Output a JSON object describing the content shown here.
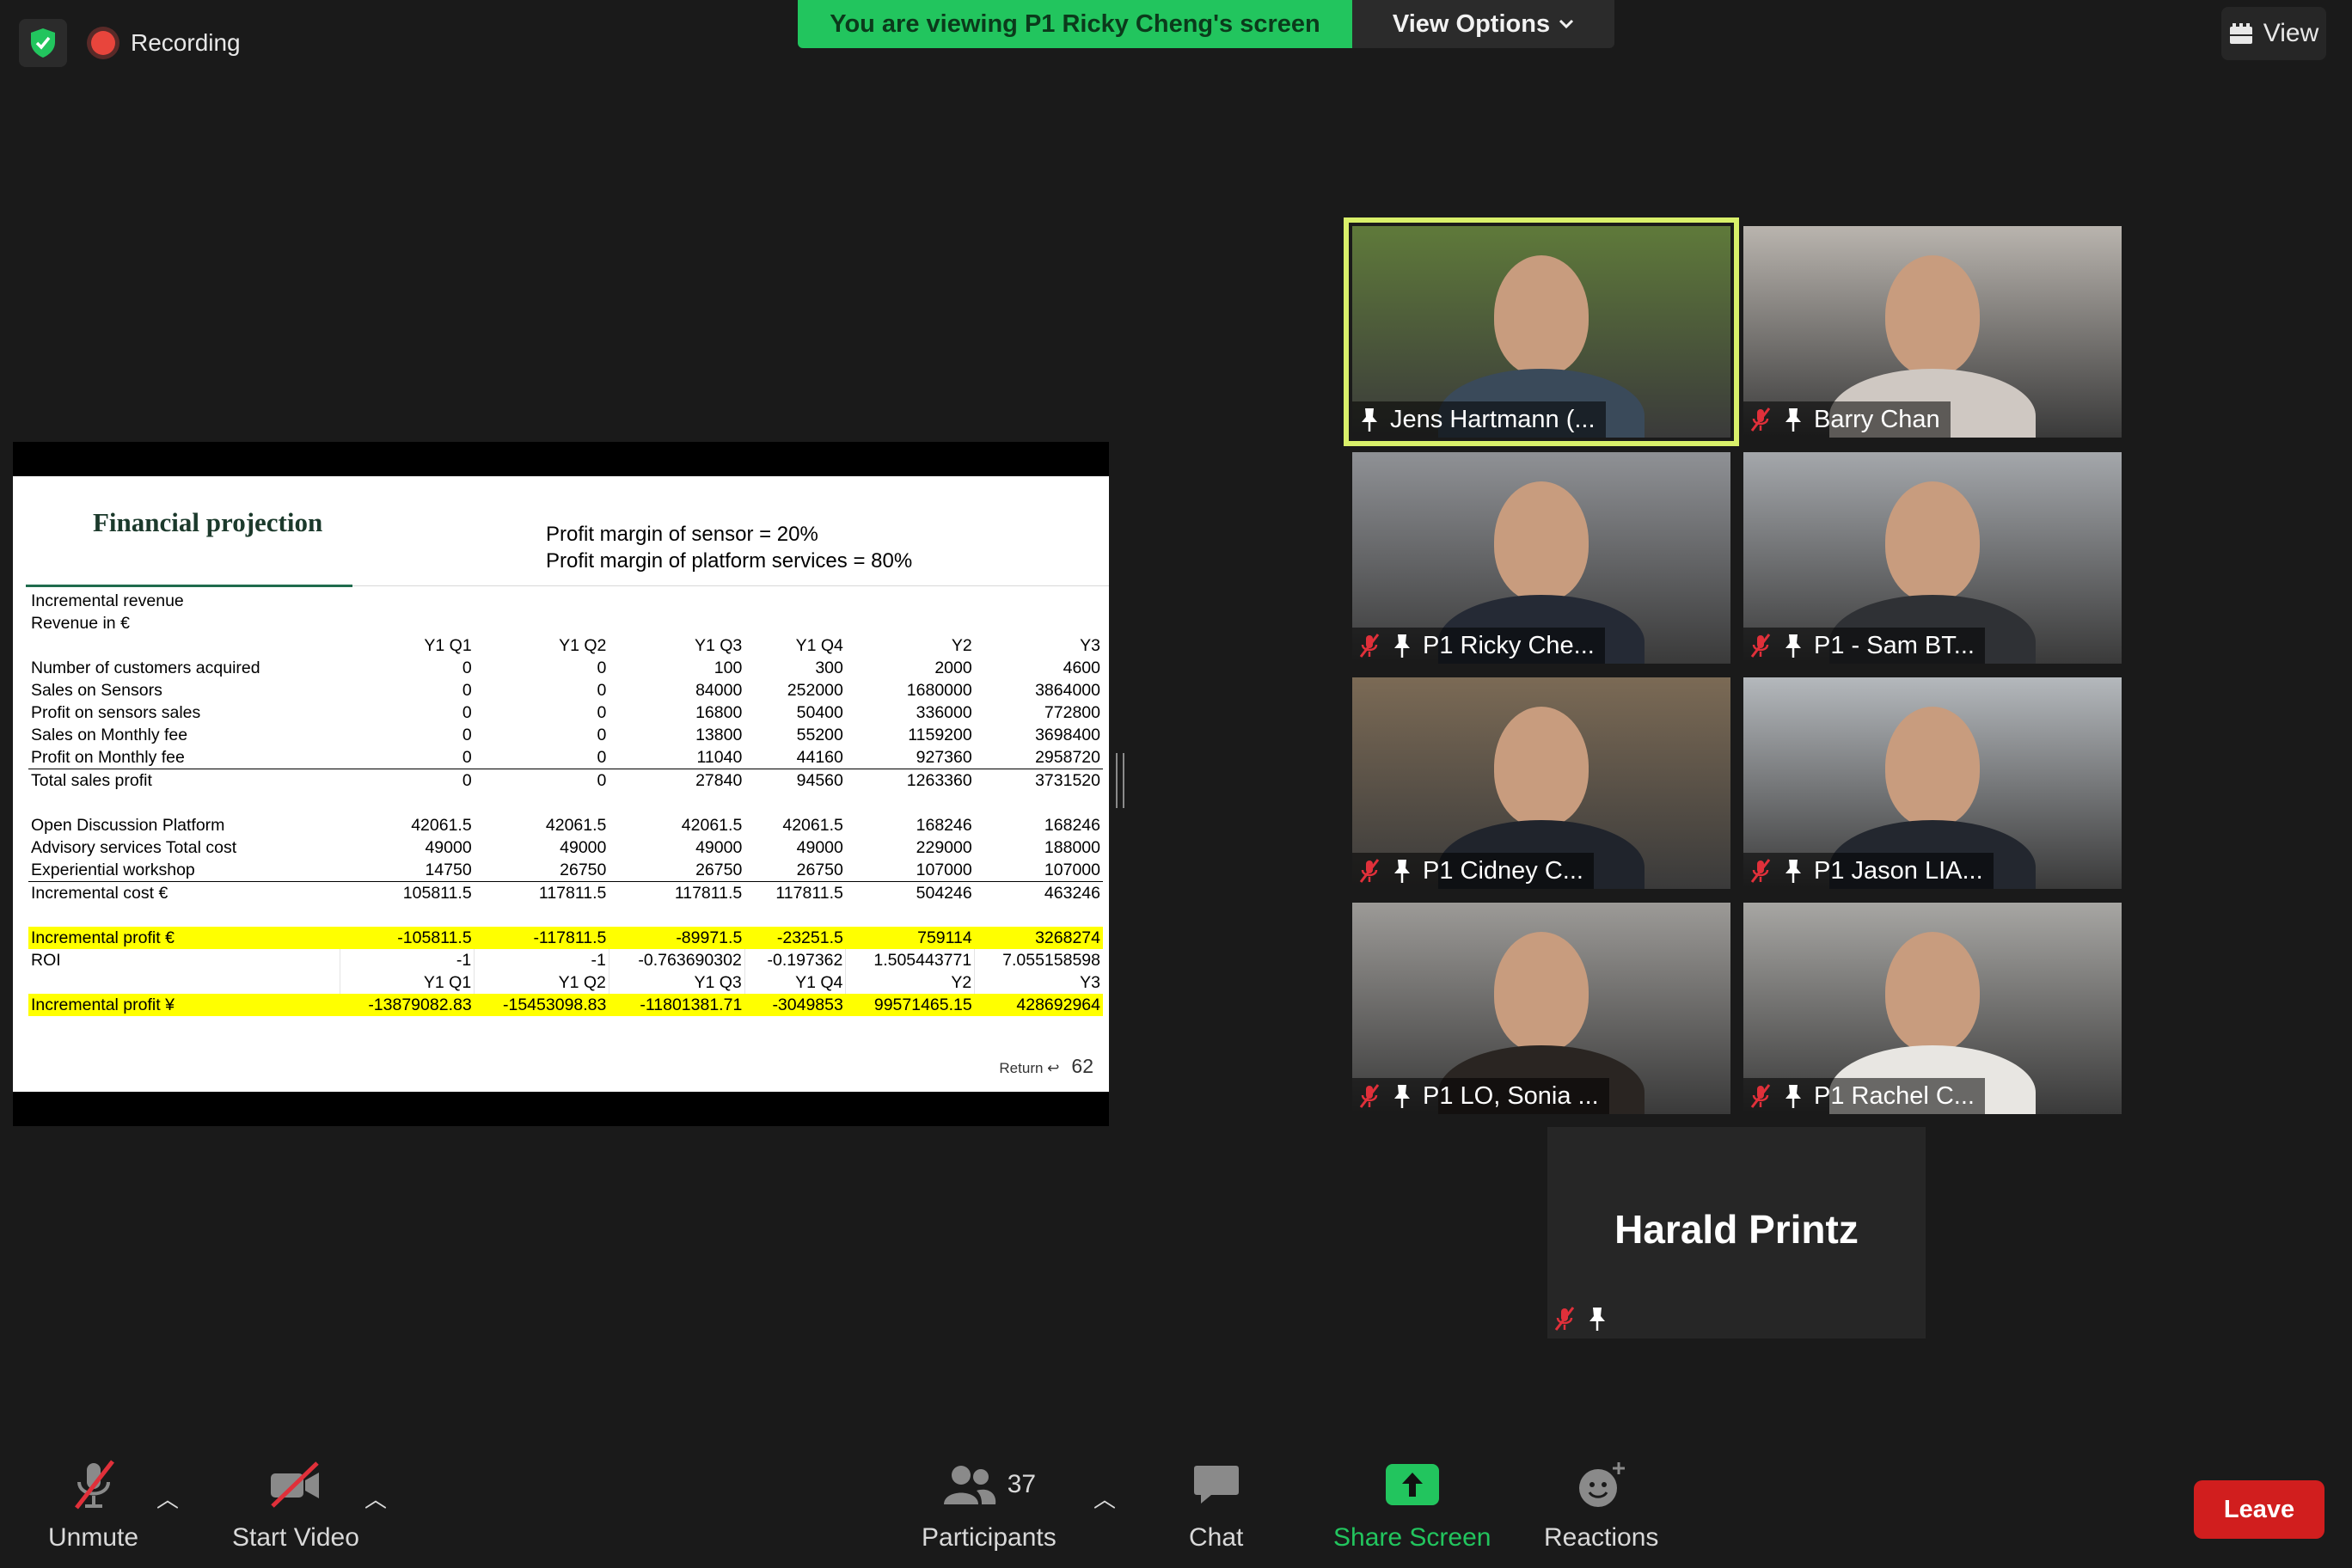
{
  "top": {
    "recording_label": "Recording",
    "viewing_banner": "You are viewing P1 Ricky Cheng's screen",
    "view_options_label": "View Options",
    "view_label": "View"
  },
  "slide": {
    "title": "Financial projection",
    "margin_line_1": "Profit margin of sensor = 20%",
    "margin_line_2": "Profit margin of platform services = 80%",
    "section_label_1": "Incremental revenue",
    "section_label_2": "Revenue in €",
    "column_headers": [
      "Y1 Q1",
      "Y1 Q2",
      "Y1 Q3",
      "Y1 Q4",
      "Y2",
      "Y3"
    ],
    "revenue_rows": [
      {
        "label": "Number of customers acquired",
        "values": [
          "0",
          "0",
          "100",
          "300",
          "2000",
          "4600"
        ]
      },
      {
        "label": "Sales on Sensors",
        "values": [
          "0",
          "0",
          "84000",
          "252000",
          "1680000",
          "3864000"
        ]
      },
      {
        "label": "Profit on sensors sales",
        "values": [
          "0",
          "0",
          "16800",
          "50400",
          "336000",
          "772800"
        ]
      },
      {
        "label": "Sales on Monthly fee",
        "values": [
          "0",
          "0",
          "13800",
          "55200",
          "1159200",
          "3698400"
        ]
      },
      {
        "label": "Profit on Monthly fee",
        "values": [
          "0",
          "0",
          "11040",
          "44160",
          "927360",
          "2958720"
        ]
      },
      {
        "label": "Total sales profit",
        "values": [
          "0",
          "0",
          "27840",
          "94560",
          "1263360",
          "3731520"
        ]
      }
    ],
    "cost_rows": [
      {
        "label": "Open Discussion Platform",
        "values": [
          "42061.5",
          "42061.5",
          "42061.5",
          "42061.5",
          "168246",
          "168246"
        ]
      },
      {
        "label": "Advisory services Total cost",
        "values": [
          "49000",
          "49000",
          "49000",
          "49000",
          "229000",
          "188000"
        ]
      },
      {
        "label": "Experiential workshop",
        "values": [
          "14750",
          "26750",
          "26750",
          "26750",
          "107000",
          "107000"
        ]
      },
      {
        "label": "Incremental cost €",
        "values": [
          "105811.5",
          "117811.5",
          "117811.5",
          "117811.5",
          "504246",
          "463246"
        ]
      }
    ],
    "profit_row": {
      "label": "Incremental profit €",
      "values": [
        "-105811.5",
        "-117811.5",
        "-89971.5",
        "-23251.5",
        "759114",
        "3268274"
      ]
    },
    "roi_row": {
      "label": "ROI",
      "values": [
        "-1",
        "-1",
        "-0.763690302",
        "-0.197362",
        "1.505443771",
        "7.055158598"
      ]
    },
    "yen_row": {
      "label": "Incremental profit ¥",
      "values": [
        "-13879082.83",
        "-15453098.83",
        "-11801381.71",
        "-3049853",
        "99571465.15",
        "428692964"
      ]
    },
    "return_label": "Return ↩",
    "page_number": "62"
  },
  "participants": [
    {
      "name": "Jens Hartmann (...",
      "muted": false,
      "bg": "#5f7a3a",
      "shirt": "#3a4a5a"
    },
    {
      "name": "Barry Chan",
      "muted": true,
      "bg": "#b9b4ae",
      "shirt": "#cfc8c2"
    },
    {
      "name": "P1 Ricky Che...",
      "muted": true,
      "bg": "#8f9195",
      "shirt": "#252a35"
    },
    {
      "name": "P1 - Sam BT...",
      "muted": true,
      "bg": "#a4a7ab",
      "shirt": "#2f3135"
    },
    {
      "name": "P1 Cidney C...",
      "muted": true,
      "bg": "#7b6a55",
      "shirt": "#20242c"
    },
    {
      "name": "P1 Jason LIA...",
      "muted": true,
      "bg": "#b4b8bc",
      "shirt": "#23272f"
    },
    {
      "name": "P1 LO, Sonia ...",
      "muted": true,
      "bg": "#9c9a97",
      "shirt": "#2a2522"
    },
    {
      "name": "P1 Rachel C...",
      "muted": true,
      "bg": "#a7a6a3",
      "shirt": "#e8e6e2"
    }
  ],
  "harald": {
    "name": "Harald Printz"
  },
  "toolbar": {
    "unmute_label": "Unmute",
    "start_video_label": "Start Video",
    "participants_label": "Participants",
    "participants_count": "37",
    "chat_label": "Chat",
    "share_screen_label": "Share Screen",
    "reactions_label": "Reactions",
    "leave_label": "Leave"
  },
  "colors": {
    "banner": "#22c55e",
    "share_screen": "#22c55e",
    "leave": "#d11e1e",
    "active_speaker": "#d9f06a",
    "highlight_row": "#ffff00"
  }
}
